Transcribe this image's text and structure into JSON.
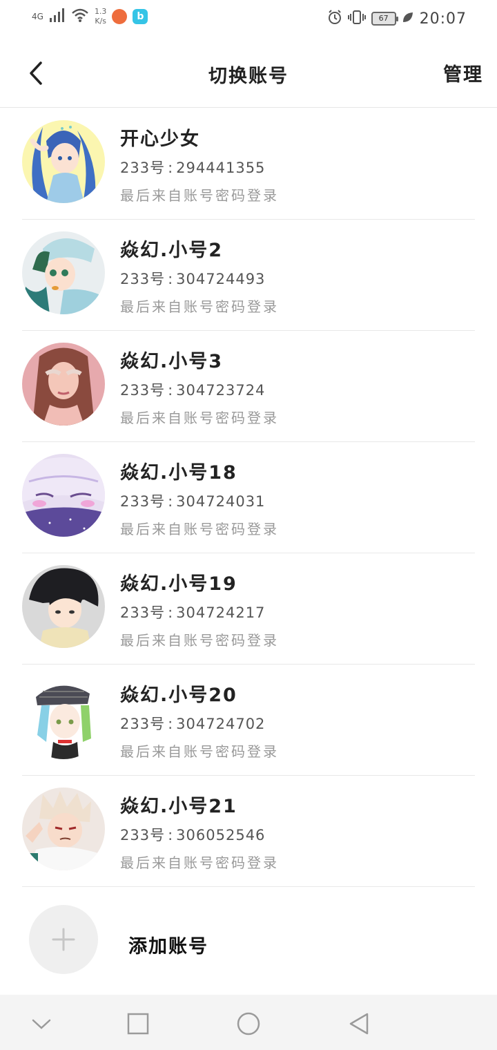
{
  "status_bar": {
    "network": "4G",
    "speed_value": "1.3",
    "speed_unit": "K/s",
    "battery": "67",
    "time": "20:07",
    "icons": [
      "signal-icon",
      "wifi-icon",
      "app-notification-icon",
      "bilibili-icon",
      "alarm-icon",
      "vibrate-icon",
      "battery-icon",
      "leaf-icon"
    ]
  },
  "header": {
    "title": "切换账号",
    "manage_label": "管理",
    "back_icon": "chevron-left-icon"
  },
  "accounts": [
    {
      "name": "开心少女",
      "id_label": "233号",
      "id_value": "294441355",
      "login_method": "最后来自账号密码登录",
      "avatar": "anime-girl-blue-hair"
    },
    {
      "name": "焱幻.小号2",
      "id_label": "233号",
      "id_value": "304724493",
      "login_method": "最后来自账号密码登录",
      "avatar": "anime-boy-green-hair"
    },
    {
      "name": "焱幻.小号3",
      "id_label": "233号",
      "id_value": "304723724",
      "login_method": "最后来自账号密码登录",
      "avatar": "girl-pink-portrait"
    },
    {
      "name": "焱幻.小号18",
      "id_label": "233号",
      "id_value": "304724031",
      "login_method": "最后来自账号密码登录",
      "avatar": "anime-girl-lavender-hair"
    },
    {
      "name": "焱幻.小号19",
      "id_label": "233号",
      "id_value": "304724217",
      "login_method": "最后来自账号密码登录",
      "avatar": "anime-boy-black-hair"
    },
    {
      "name": "焱幻.小号20",
      "id_label": "233号",
      "id_value": "304724702",
      "login_method": "最后来自账号密码登录",
      "avatar": "anime-character-beret"
    },
    {
      "name": "焱幻.小号21",
      "id_label": "233号",
      "id_value": "306052546",
      "login_method": "最后来自账号密码登录",
      "avatar": "anime-boy-blonde-hair"
    }
  ],
  "add_account": {
    "label": "添加账号",
    "icon": "plus-icon"
  },
  "nav_bar": {
    "icons": [
      "collapse-down-icon",
      "recents-square-icon",
      "home-circle-icon",
      "back-triangle-icon"
    ]
  }
}
